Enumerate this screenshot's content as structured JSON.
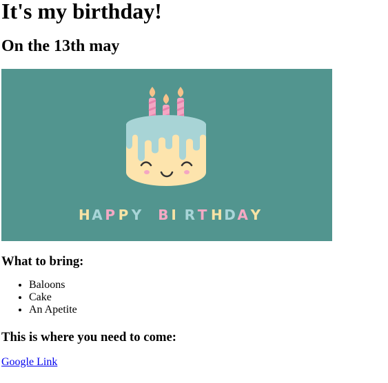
{
  "page": {
    "title": "It's my birthday!",
    "subtitle": "On the 13th may"
  },
  "banner": {
    "background_color": "#52958f",
    "text_letters": [
      "H",
      "A",
      "P",
      "P",
      "Y",
      " ",
      "B",
      "I",
      "R",
      "T",
      "H",
      "D",
      "A",
      "Y"
    ],
    "letter_colors": [
      "#f7e3a5",
      "#a8d5d8",
      "#f4a9c4",
      "#f7e3a5",
      "#a8d5d8",
      "",
      "#f4a9c4",
      "#f7e3a5",
      "#a8d5d8",
      "#f4a9c4",
      "#f7e3a5",
      "#a8d5d8",
      "#f4a9c4",
      "#f7e3a5"
    ],
    "cake_color": "#fde4ad",
    "icing_color": "#a8d4d6",
    "candle_color": "#f4a6c3",
    "flame_color": "#f6c28b"
  },
  "bring": {
    "heading": "What to bring:",
    "items": [
      "Baloons",
      "Cake",
      "An Apetite"
    ]
  },
  "location": {
    "heading": "This is where you need to come:",
    "link_text": "Google Link"
  }
}
